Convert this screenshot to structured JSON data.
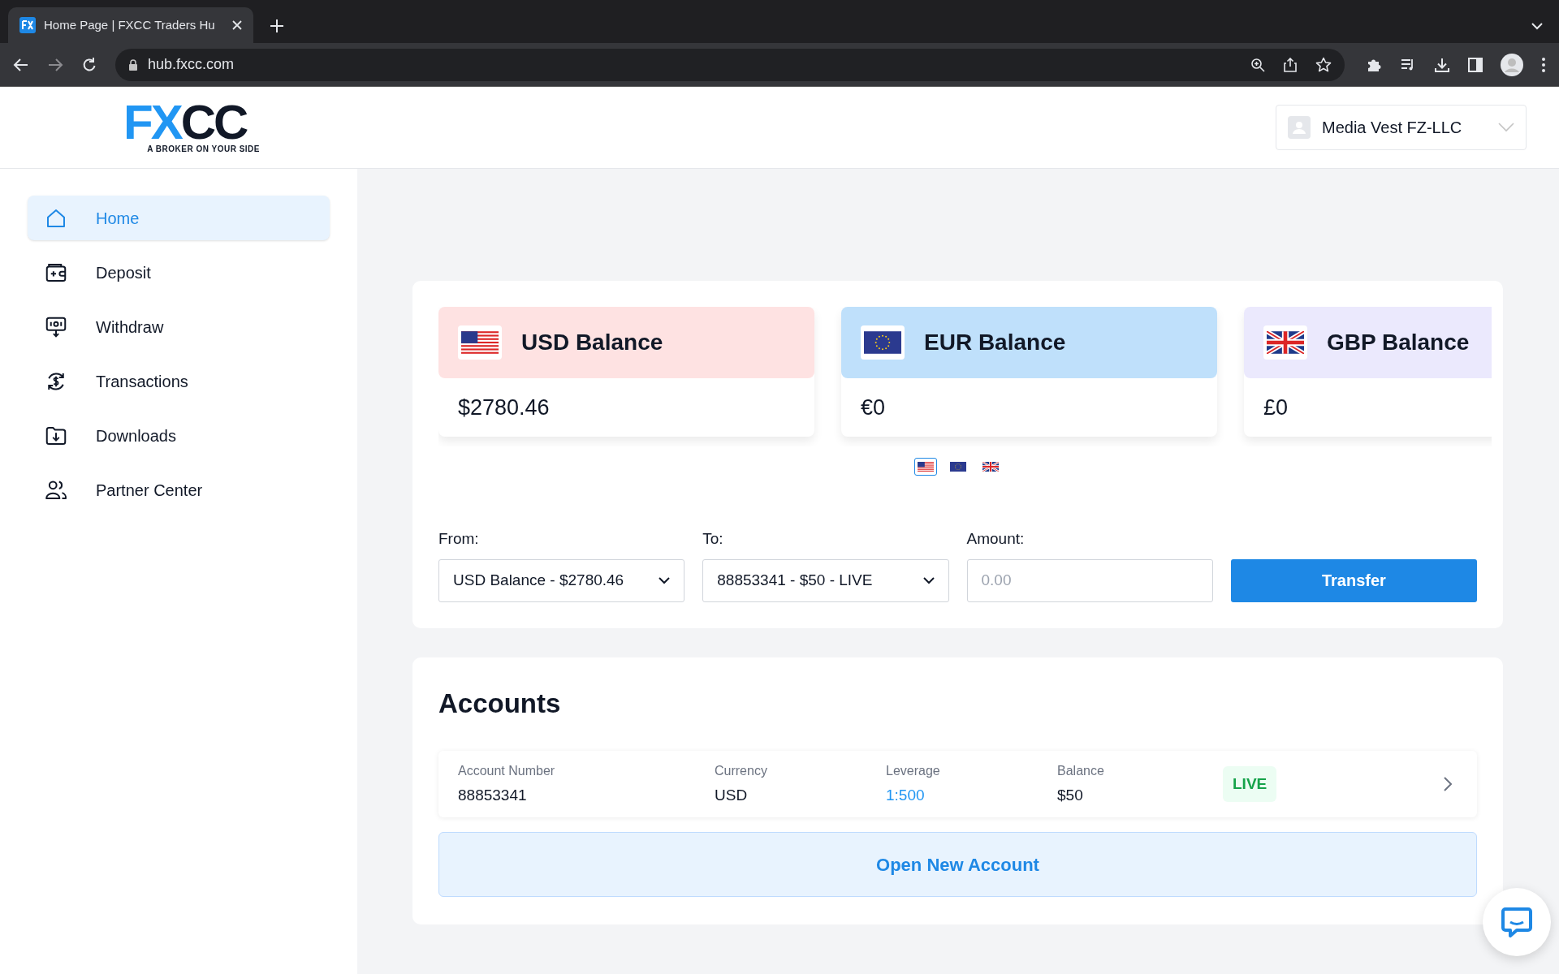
{
  "browser": {
    "tab_title": "Home Page | FXCC Traders Hu",
    "url": "hub.fxcc.com"
  },
  "header": {
    "logo": {
      "part_a": "FX",
      "part_b": "CC",
      "tagline": "A BROKER ON YOUR SIDE"
    },
    "account_menu": {
      "label": "Media Vest FZ-LLC"
    }
  },
  "sidebar": {
    "items": [
      {
        "label": "Home",
        "kind": "home",
        "selected": true
      },
      {
        "label": "Deposit",
        "kind": "deposit",
        "selected": false
      },
      {
        "label": "Withdraw",
        "kind": "withdraw",
        "selected": false
      },
      {
        "label": "Transactions",
        "kind": "transactions",
        "selected": false
      },
      {
        "label": "Downloads",
        "kind": "downloads",
        "selected": false
      },
      {
        "label": "Partner Center",
        "kind": "partner",
        "selected": false
      }
    ]
  },
  "balances": [
    {
      "kind": "us",
      "title": "USD Balance",
      "amount": "$2780.46",
      "color": "#fee2e2"
    },
    {
      "kind": "eu",
      "title": "EUR Balance",
      "amount": "€0",
      "color": "#bfe0fb"
    },
    {
      "kind": "gb",
      "title": "GBP Balance",
      "amount": "£0",
      "color": "#ebe9fd"
    }
  ],
  "carousel": [
    {
      "kind": "us",
      "selected": true
    },
    {
      "kind": "eu",
      "selected": false
    },
    {
      "kind": "gb",
      "selected": false
    }
  ],
  "transfer": {
    "from_label": "From:",
    "from_value": "USD Balance - $2780.46",
    "to_label": "To:",
    "to_value": "88853341 - $50 - LIVE",
    "amount_label": "Amount:",
    "amount_placeholder": "0.00",
    "button": "Transfer"
  },
  "accounts": {
    "title": "Accounts",
    "rows": [
      {
        "cells": [
          {
            "label": "Account Number",
            "value": "88853341",
            "kind": "plain"
          },
          {
            "label": "Currency",
            "value": "USD",
            "kind": "plain"
          },
          {
            "label": "Leverage",
            "value": "1:500",
            "kind": "link"
          },
          {
            "label": "Balance",
            "value": "$50",
            "kind": "plain"
          }
        ],
        "status": "LIVE"
      }
    ],
    "open_button": "Open New Account"
  }
}
